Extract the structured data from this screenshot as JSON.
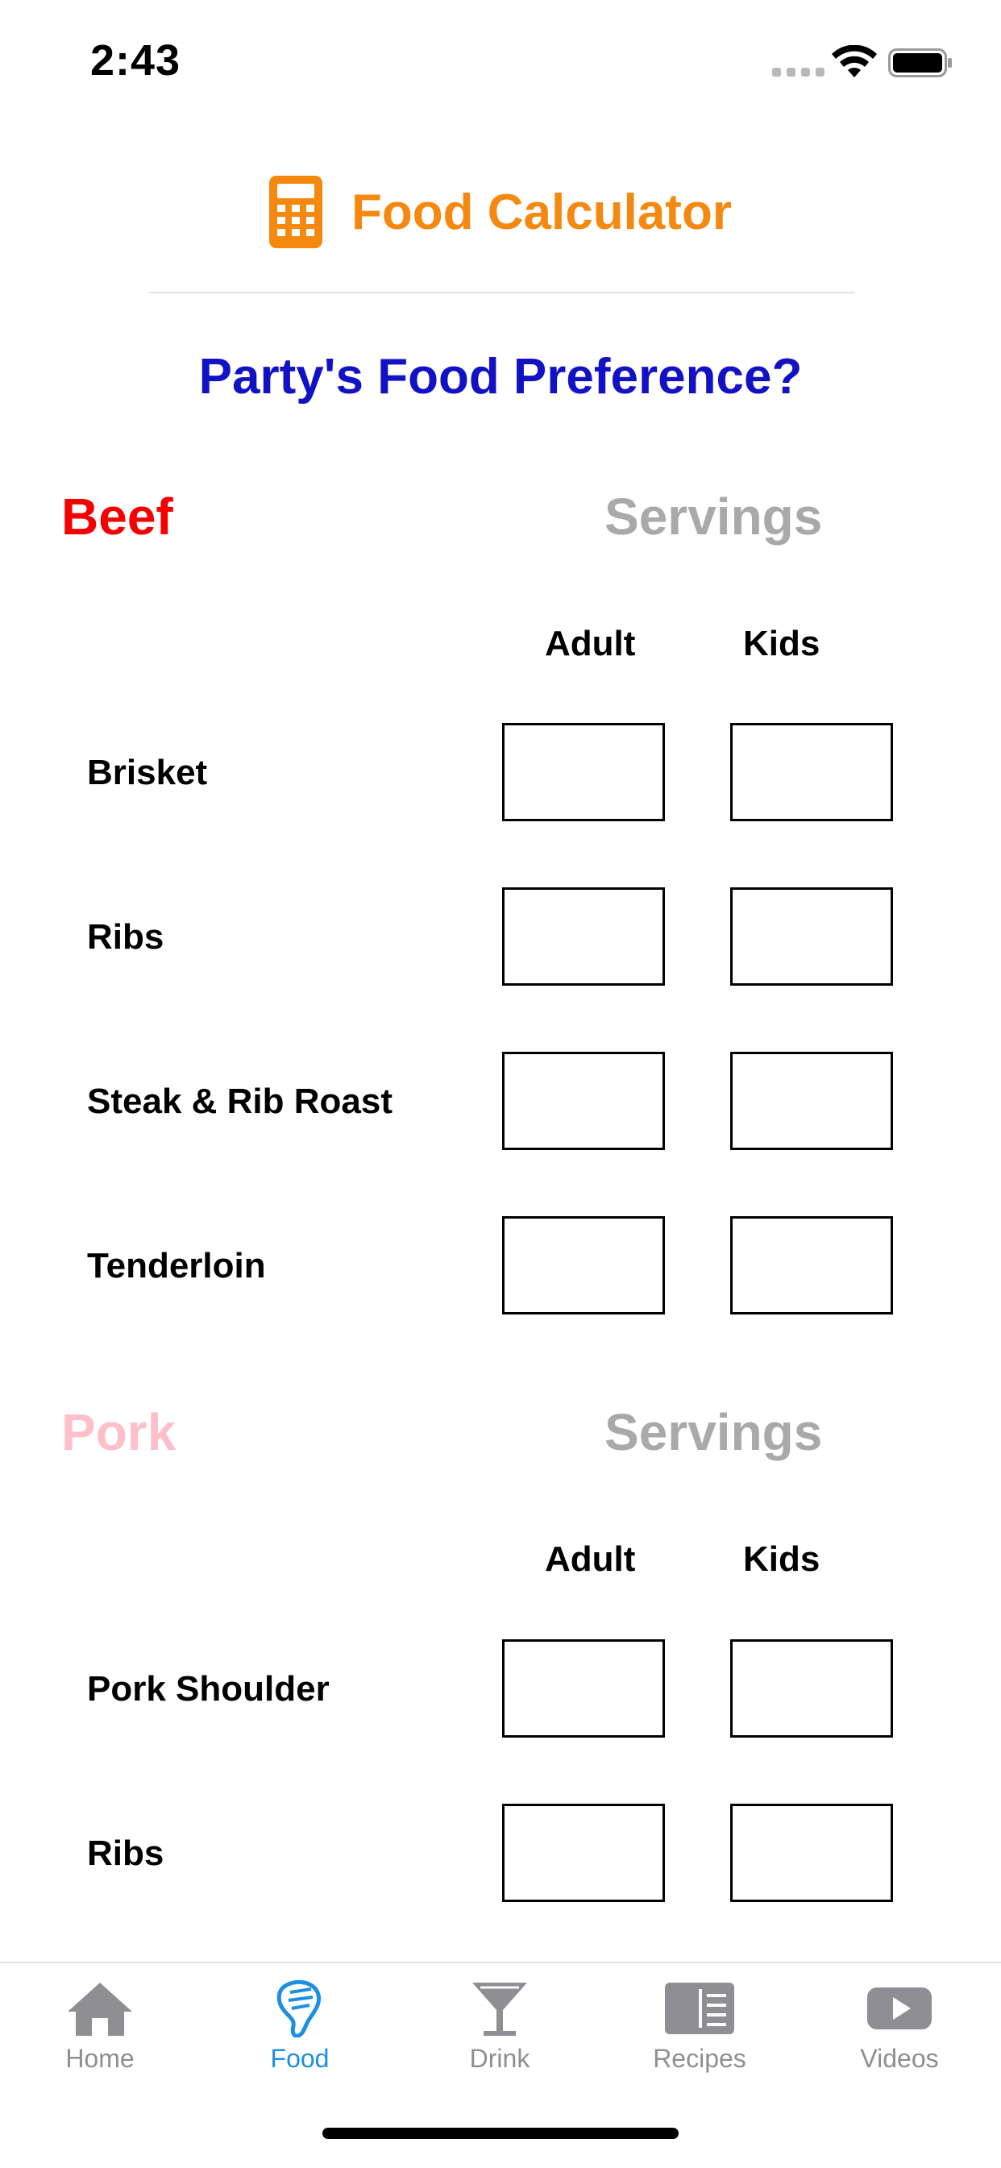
{
  "status_bar": {
    "time": "2:43"
  },
  "header": {
    "title": "Food Calculator",
    "icon": "calculator-icon"
  },
  "question": "Party's Food Preference?",
  "colors": {
    "accent_orange": "#f5880f",
    "question_blue": "#1212c4",
    "beef_red": "#f40000",
    "pork_pink": "#ffbfca",
    "servings_gray": "#a9a9a9",
    "tab_active": "#1d8fe3",
    "tab_inactive": "#8e8e93"
  },
  "sections": [
    {
      "category": "Beef",
      "servings_label": "Servings",
      "col_adult": "Adult",
      "col_kids": "Kids",
      "items": [
        {
          "label": "Brisket",
          "adult": "",
          "kids": ""
        },
        {
          "label": "Ribs",
          "adult": "",
          "kids": ""
        },
        {
          "label": "Steak & Rib Roast",
          "adult": "",
          "kids": ""
        },
        {
          "label": "Tenderloin",
          "adult": "",
          "kids": ""
        }
      ]
    },
    {
      "category": "Pork",
      "servings_label": "Servings",
      "col_adult": "Adult",
      "col_kids": "Kids",
      "items": [
        {
          "label": "Pork Shoulder",
          "adult": "",
          "kids": ""
        },
        {
          "label": "Ribs",
          "adult": "",
          "kids": ""
        }
      ]
    }
  ],
  "tabbar": {
    "items": [
      {
        "label": "Home",
        "icon": "house-icon",
        "active": false
      },
      {
        "label": "Food",
        "icon": "meat-icon",
        "active": true
      },
      {
        "label": "Drink",
        "icon": "cocktail-glass-icon",
        "active": false
      },
      {
        "label": "Recipes",
        "icon": "recipe-book-icon",
        "active": false
      },
      {
        "label": "Videos",
        "icon": "play-video-icon",
        "active": false
      }
    ]
  }
}
